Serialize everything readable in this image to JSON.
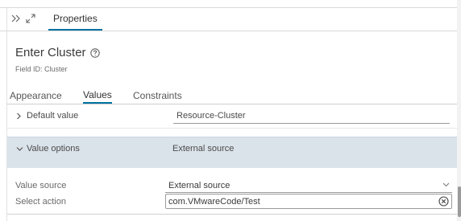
{
  "header": {
    "collapse_icon": "double-chevron-right-icon",
    "expand_icon": "expand-arrows-icon",
    "tab_label": "Properties"
  },
  "field": {
    "title": "Enter Cluster",
    "help_icon": "help-circle-icon",
    "field_id": "Field ID: Cluster"
  },
  "tabs": [
    {
      "label": "Appearance"
    },
    {
      "label": "Values",
      "active": true
    },
    {
      "label": "Constraints"
    }
  ],
  "default_value": {
    "label": "Default value",
    "value": "Resource-Cluster",
    "expanded": false
  },
  "value_options": {
    "label": "Value options",
    "summary": "External source",
    "expanded": true,
    "value_source": {
      "label": "Value source",
      "selected": "External source"
    },
    "select_action": {
      "label": "Select action",
      "value": "com.VMwareCode/Test",
      "clear_icon": "clear-circle-icon"
    }
  },
  "colors": {
    "accent": "#0072a3",
    "section_highlight": "#dbe3ea"
  }
}
